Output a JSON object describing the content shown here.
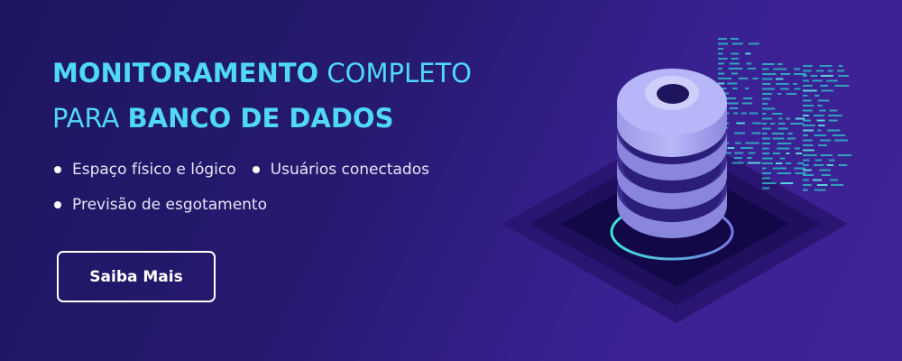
{
  "headline": {
    "line1_bold": "MONITORAMENTO",
    "line1_light": "COMPLETO",
    "line2_light": "PARA",
    "line2_bold": "BANCO DE DADOS"
  },
  "features": [
    "Espaço físico e lógico",
    "Usuários conectados",
    "Previsão de esgotamento"
  ],
  "cta": {
    "label": "Saiba Mais"
  },
  "colors": {
    "accent": "#4fd8f7",
    "background": "#261a70",
    "database": "#b3b2f5"
  },
  "illustration": {
    "icon": "database-server-icon"
  }
}
